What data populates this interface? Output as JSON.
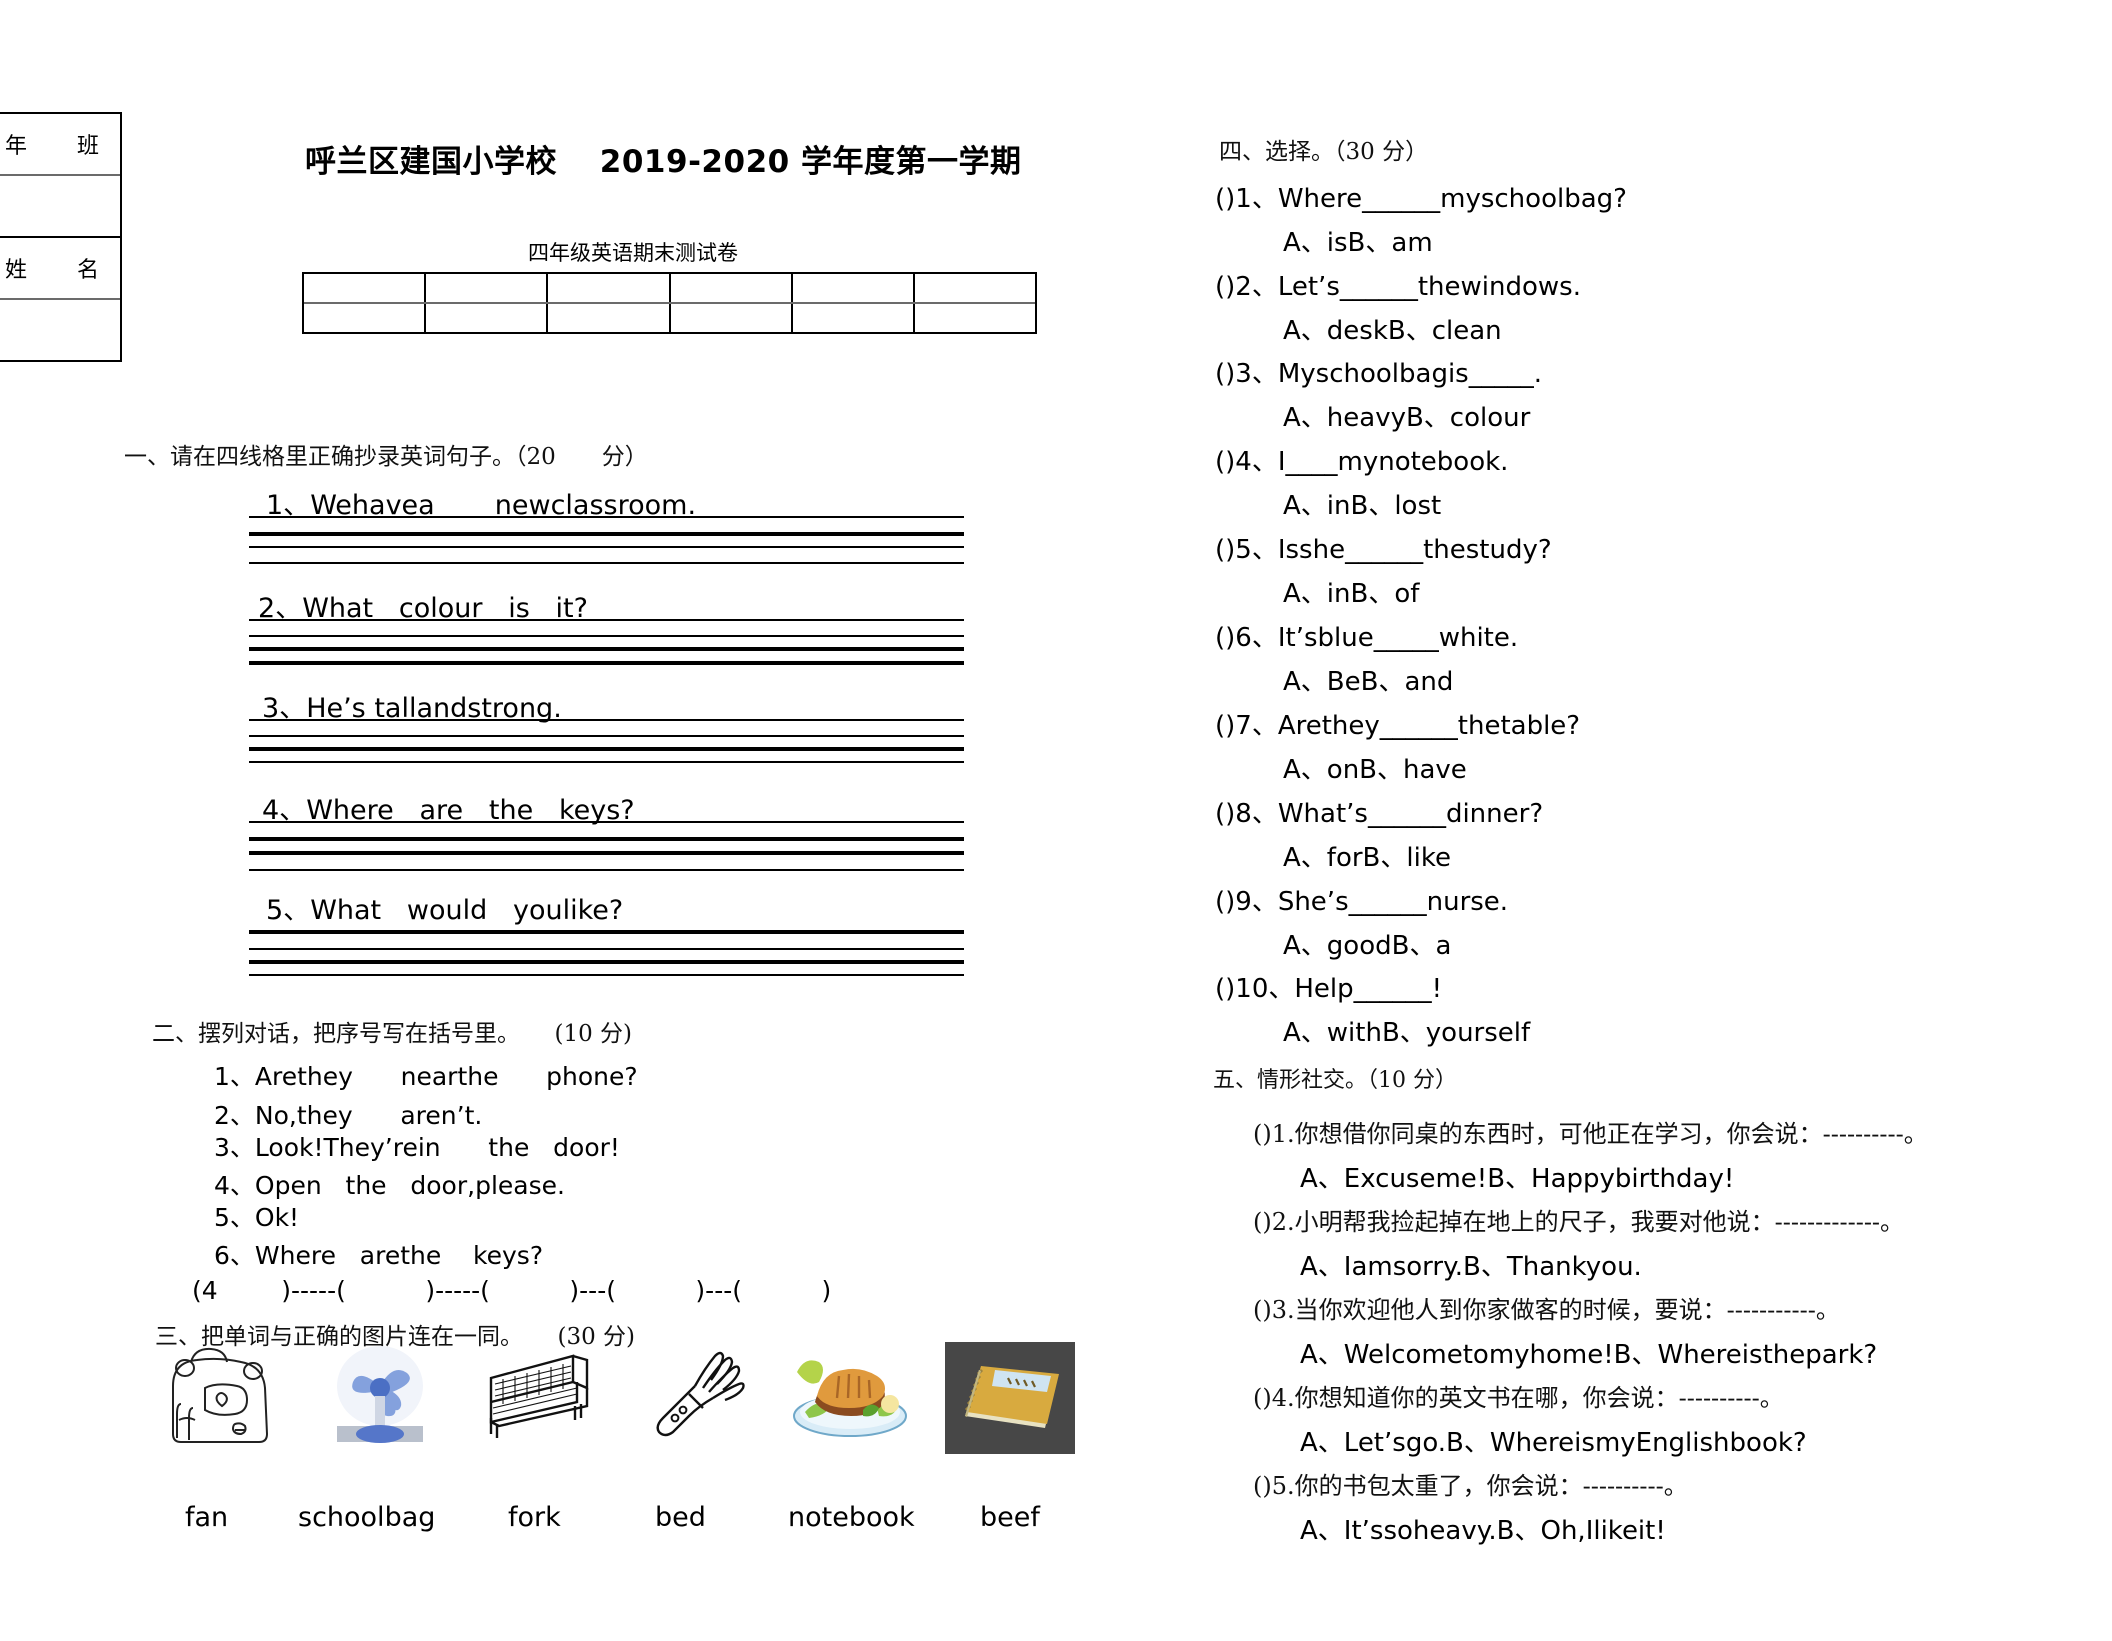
{
  "info_box": {
    "rows": [
      {
        "label": "年　班",
        "type": "label"
      },
      {
        "label": "",
        "type": "blank"
      },
      {
        "label": "姓　名",
        "type": "label"
      },
      {
        "label": "",
        "type": "blank"
      }
    ]
  },
  "header": {
    "title": "呼兰区建国小学校　 2019-2020 学年度第一学期",
    "subtitle": "四年级英语期末测试卷",
    "score_table": {
      "columns": 6,
      "rows": 2,
      "cells": [
        "",
        "",
        "",
        "",
        "",
        "",
        "",
        "",
        "",
        "",
        "",
        ""
      ]
    }
  },
  "section1": {
    "heading": "一、请在四线格里正确抄录英词句子。（20　　分）",
    "items": [
      {
        "num": "1、",
        "text": "Wehavea       newclassroom."
      },
      {
        "num": "2、",
        "text": "What   colour   is   it?"
      },
      {
        "num": "3、",
        "text": "He’s tallandstrong."
      },
      {
        "num": "4、",
        "text": "Where   are   the   keys?"
      },
      {
        "num": "5、",
        "text": "What   would   youlike?"
      }
    ]
  },
  "section2": {
    "heading": "二、摆列对话，把序号写在括号里。　　(10 分)",
    "items": [
      "1、Arethey      nearthe      phone?",
      "2、No,they      aren’t.",
      "3、Look!They’rein      the   door!",
      "4、Open   the   door,please.",
      "5、Ok!",
      "6、Where   arethe    keys?"
    ],
    "answer_line": "(4        )-----(          )-----(          )---(          )---(          )"
  },
  "section3": {
    "heading": "三、把单词与正确的图片连在一同。　　(30    分)",
    "pictures": [
      {
        "icon": "schoolbag-picture",
        "alt": "schoolbag"
      },
      {
        "icon": "fan-picture",
        "alt": "fan"
      },
      {
        "icon": "bed-picture",
        "alt": "bed"
      },
      {
        "icon": "fork-picture",
        "alt": "fork"
      },
      {
        "icon": "beef-picture",
        "alt": "beef"
      },
      {
        "icon": "notebook-picture",
        "alt": "notebook"
      }
    ],
    "words": [
      "fan",
      "schoolbag",
      "fork",
      "bed",
      "notebook",
      "beef"
    ]
  },
  "section4": {
    "heading": "四、选择。（30 分）",
    "questions": [
      {
        "stem": "()1、Where______myschoolbag?",
        "options": "A、isB、am"
      },
      {
        "stem": "()2、Let’s______thewindows.",
        "options": "A、deskB、clean"
      },
      {
        "stem": "()3、Myschoolbagis_____.",
        "options": "A、heavyB、colour"
      },
      {
        "stem": "()4、I____mynotebook.",
        "options": "A、inB、lost"
      },
      {
        "stem": "()5、Isshe______thestudy?",
        "options": "A、inB、of"
      },
      {
        "stem": "()6、It’sblue_____white.",
        "options": "A、BeB、and"
      },
      {
        "stem": "()7、Arethey______thetable?",
        "options": "A、onB、have"
      },
      {
        "stem": "()8、What’s______dinner?",
        "options": "A、forB、like"
      },
      {
        "stem": "()9、She’s______nurse.",
        "options": "A、goodB、a"
      },
      {
        "stem": "()10、Help______!",
        "options": "A、withB、yourself"
      }
    ]
  },
  "section5": {
    "heading": "五、情形社交。（10 分）",
    "questions": [
      {
        "stem": "()1.你想借你同桌的东西时，可他正在学习，你会说：----------。",
        "options": "A、Excuseme!B、Happybirthday!"
      },
      {
        "stem": "()2.小明帮我捡起掉在地上的尺子，我要对他说：-------------。",
        "options": "A、Iamsorry.B、Thankyou."
      },
      {
        "stem": "()3.当你欢迎他人到你家做客的时候，要说：-----------。",
        "options": "A、Welcometomyhome!B、Whereisthepark?"
      },
      {
        "stem": "()4.你想知道你的英文书在哪，你会说：----------。",
        "options": "A、Let’sgo.B、WhereismyEnglishbook?"
      },
      {
        "stem": "()5.你的书包太重了，你会说：----------。",
        "options": "A、It’ssoheavy.B、Oh,Ilikeit!"
      }
    ]
  }
}
